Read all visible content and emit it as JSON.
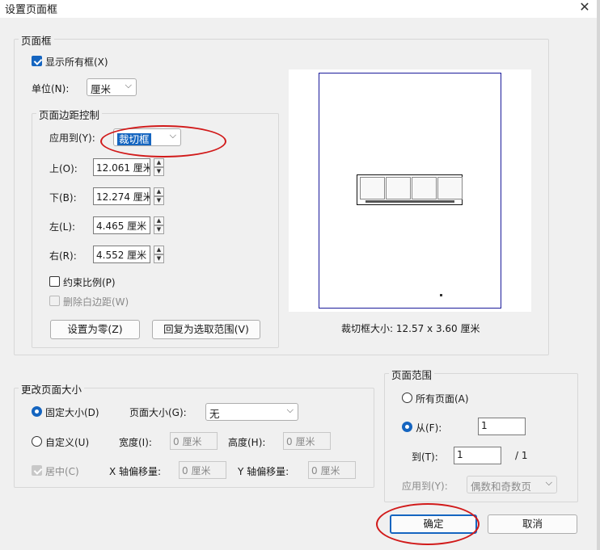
{
  "title": "设置页面框",
  "page_frame": {
    "legend": "页面框",
    "show_all_label": "显示所有框(X)",
    "unit_label": "单位(N):",
    "unit_value": "厘米",
    "margin_legend": "页面边距控制",
    "apply_label": "应用到(Y):",
    "apply_value": "裁切框",
    "top_label": "上(O):",
    "top_value": "12.061 厘米",
    "bottom_label": "下(B):",
    "bottom_value": "12.274 厘米",
    "left_label": "左(L):",
    "left_value": "4.465 厘米",
    "right_label": "右(R):",
    "right_value": "4.552 厘米",
    "constrain_label": "约束比例(P)",
    "remove_white_label": "删除白边距(W)",
    "set_zero_button": "设置为零(Z)",
    "revert_button": "回复为选取范围(V)",
    "crop_size": "裁切框大小: 12.57 x 3.60 厘米"
  },
  "change_size": {
    "legend": "更改页面大小",
    "fixed_label": "固定大小(D)",
    "page_size_label": "页面大小(G):",
    "page_size_value": "无",
    "custom_label": "自定义(U)",
    "width_label": "宽度(I):",
    "width_value": "0 厘米",
    "height_label": "高度(H):",
    "height_value": "0 厘米",
    "center_label": "居中(C)",
    "x_offset_label": "X 轴偏移量:",
    "x_offset_value": "0 厘米",
    "y_offset_label": "Y 轴偏移量:",
    "y_offset_value": "0 厘米"
  },
  "page_range": {
    "legend": "页面范围",
    "all_pages_label": "所有页面(A)",
    "from_label": "从(F):",
    "from_value": "1",
    "to_label": "到(T):",
    "to_value": "1",
    "total": "/ 1",
    "apply_label": "应用到(Y):",
    "apply_value": "偶数和奇数页"
  },
  "buttons": {
    "ok": "确定",
    "cancel": "取消"
  },
  "colors": {
    "accent": "#1565c0",
    "annotation": "#d11a1a",
    "page_border": "#1a1a9a"
  }
}
